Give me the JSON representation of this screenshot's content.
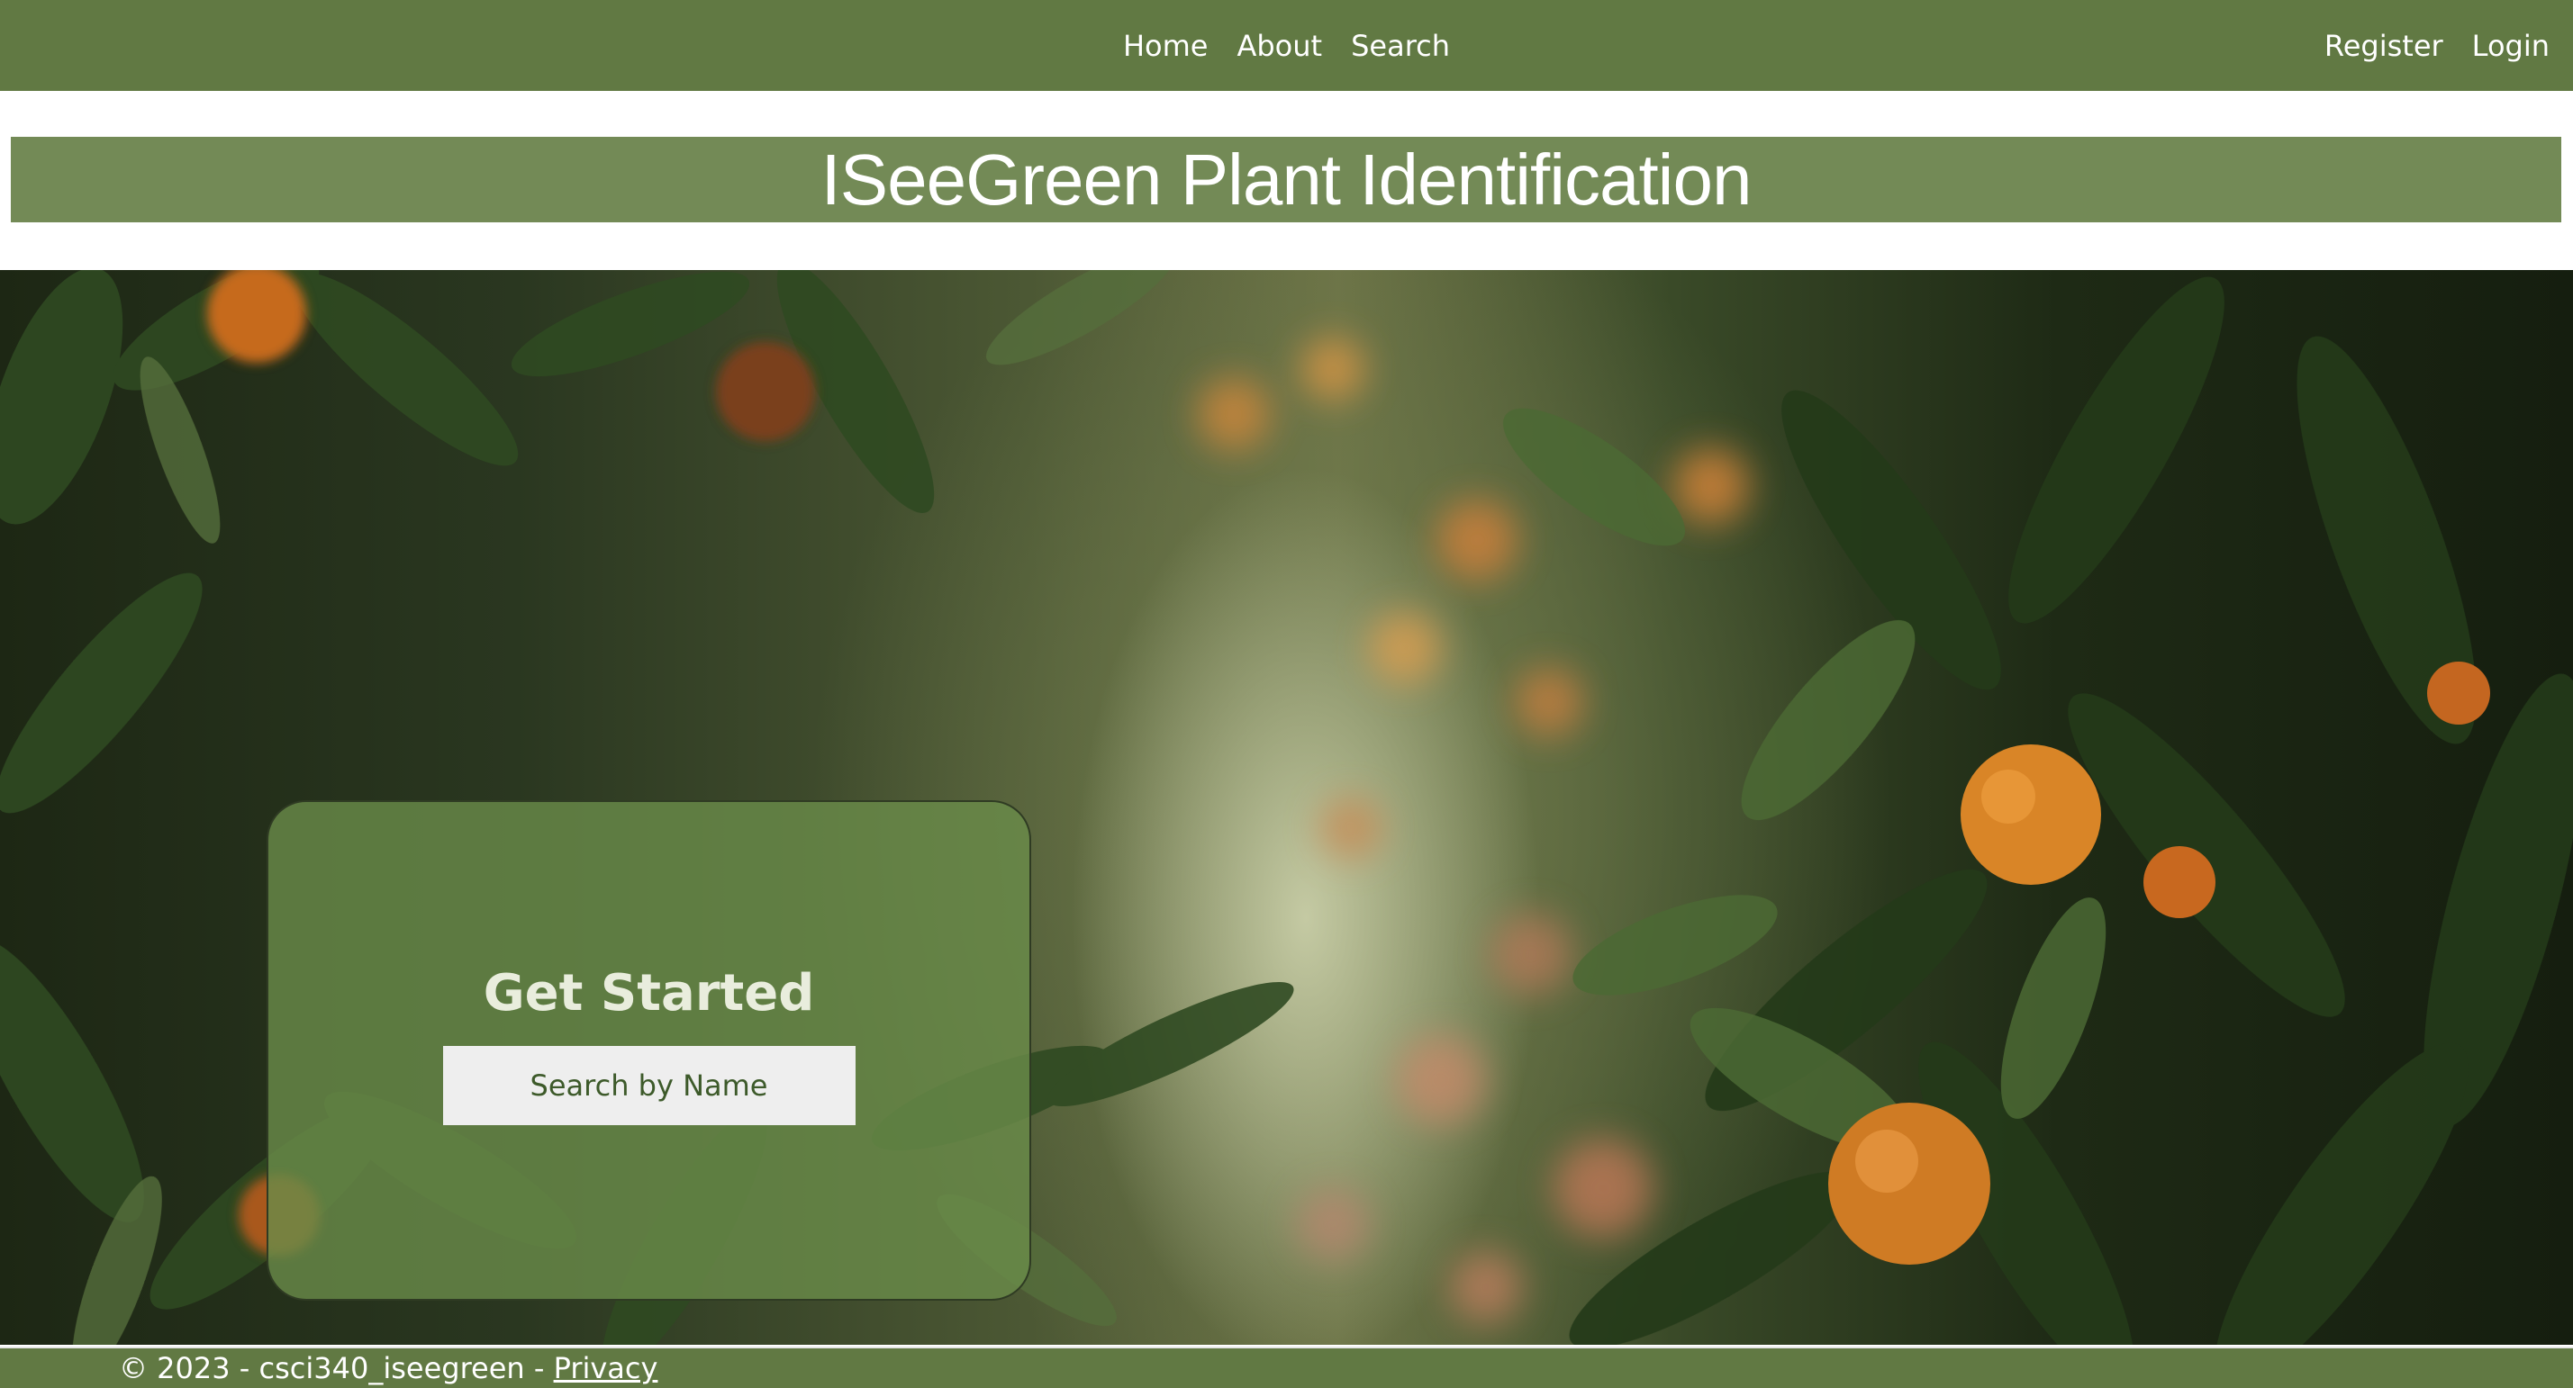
{
  "nav": {
    "center_links": [
      "Home",
      "About",
      "Search"
    ],
    "right_links": [
      "Register",
      "Login"
    ]
  },
  "banner": {
    "title": "ISeeGreen Plant Identification"
  },
  "hero": {
    "card_heading": "Get Started",
    "button_label": "Search by Name"
  },
  "footer": {
    "text": "© 2023 - csci340_iseegreen - ",
    "privacy_link": "Privacy"
  },
  "colors": {
    "nav_bg": "#617943",
    "banner_bg": "#738a56",
    "card_bg": "#6a8c4a",
    "button_text": "#3d5a2a"
  }
}
